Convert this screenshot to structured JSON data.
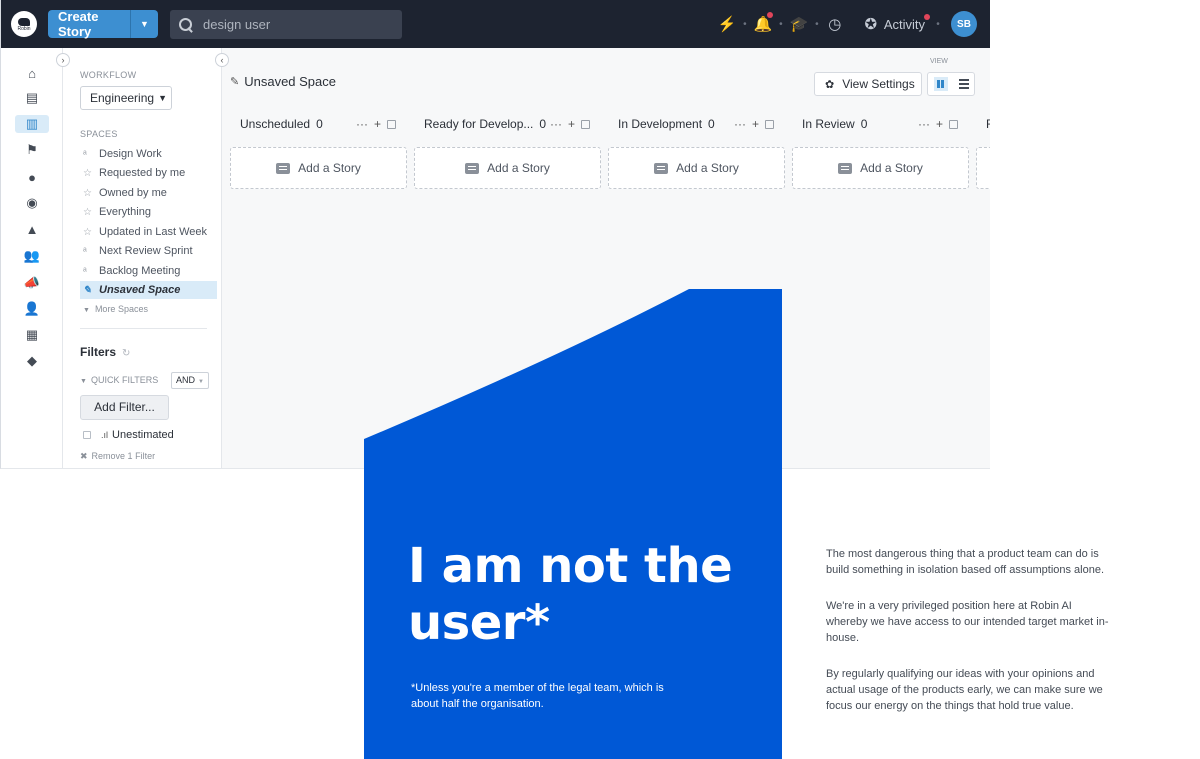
{
  "topbar": {
    "logo_text": "Robin",
    "create_label": "Create Story",
    "search_value": "design user",
    "activity_label": "Activity",
    "avatar_initials": "SB"
  },
  "sidebar": {
    "workflow_label": "WORKFLOW",
    "workflow_value": "Engineering",
    "spaces_label": "SPACES",
    "spaces": [
      {
        "label": "Design Work",
        "icon": "rss-icon"
      },
      {
        "label": "Requested by me",
        "icon": "star-icon"
      },
      {
        "label": "Owned by me",
        "icon": "star-icon"
      },
      {
        "label": "Everything",
        "icon": "star-icon"
      },
      {
        "label": "Updated in Last Week",
        "icon": "star-icon"
      },
      {
        "label": "Next Review Sprint",
        "icon": "rss-icon"
      },
      {
        "label": "Backlog Meeting",
        "icon": "rss-icon"
      },
      {
        "label": "Unsaved Space",
        "icon": "edit-icon",
        "active": true
      }
    ],
    "more_spaces": "More Spaces",
    "filters_title": "Filters",
    "quick_filters_label": "QUICK FILTERS",
    "and_value": "AND",
    "add_filter_label": "Add Filter...",
    "unestimated_label": "Unestimated",
    "remove_filter_label": "Remove 1 Filter"
  },
  "main": {
    "space_title": "Unsaved Space",
    "view_label": "VIEW",
    "view_settings_label": "View Settings",
    "add_story_label": "Add a Story",
    "columns": [
      {
        "name": "Unscheduled",
        "count": "0"
      },
      {
        "name": "Ready for Develop...",
        "count": "0"
      },
      {
        "name": "In Development",
        "count": "0"
      },
      {
        "name": "In Review",
        "count": "0"
      },
      {
        "name": "R",
        "count": ""
      }
    ]
  },
  "slide": {
    "headline": "I am not the user*",
    "footnote": "*Unless you're a member of the legal team, which is about half the organisation."
  },
  "body_copy": [
    "The most dangerous thing that a product team can do is build something in isolation based off assumptions alone.",
    "We're in a very privileged position here at Robin AI whereby we have access to our intended target market in-house.",
    "By regularly qualifying our ideas with your opinions and actual usage of the products early, we can make sure we focus our energy on the things that hold true value."
  ],
  "colors": {
    "topbar": "#1d2330",
    "accent": "#3d8fd1",
    "slide_blue": "#0058d6",
    "active_bg": "#d9ebf8"
  }
}
